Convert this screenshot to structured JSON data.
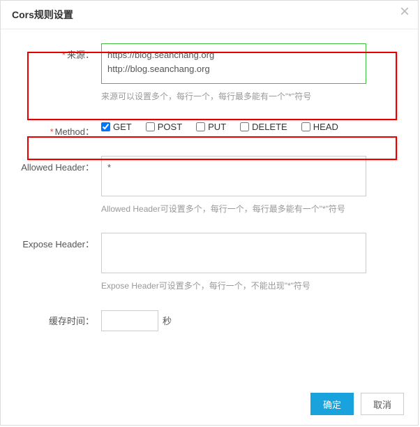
{
  "dialog": {
    "title": "Cors规则设置"
  },
  "origin": {
    "label": "来源：",
    "value": "https://blog.seanchang.org\nhttp://blog.seanchang.org",
    "hint": "来源可以设置多个，每行一个，每行最多能有一个\"*\"符号"
  },
  "method": {
    "label": "Method：",
    "options": [
      {
        "label": "GET",
        "checked": true
      },
      {
        "label": "POST",
        "checked": false
      },
      {
        "label": "PUT",
        "checked": false
      },
      {
        "label": "DELETE",
        "checked": false
      },
      {
        "label": "HEAD",
        "checked": false
      }
    ]
  },
  "allowed_header": {
    "label": "Allowed Header：",
    "value": "*",
    "hint": "Allowed Header可设置多个，每行一个，每行最多能有一个\"*\"符号"
  },
  "expose_header": {
    "label": "Expose Header：",
    "value": "",
    "hint": "Expose Header可设置多个，每行一个，不能出现\"*\"符号"
  },
  "cache": {
    "label": "缓存时间：",
    "value": "",
    "unit": "秒"
  },
  "buttons": {
    "ok": "确定",
    "cancel": "取消"
  }
}
